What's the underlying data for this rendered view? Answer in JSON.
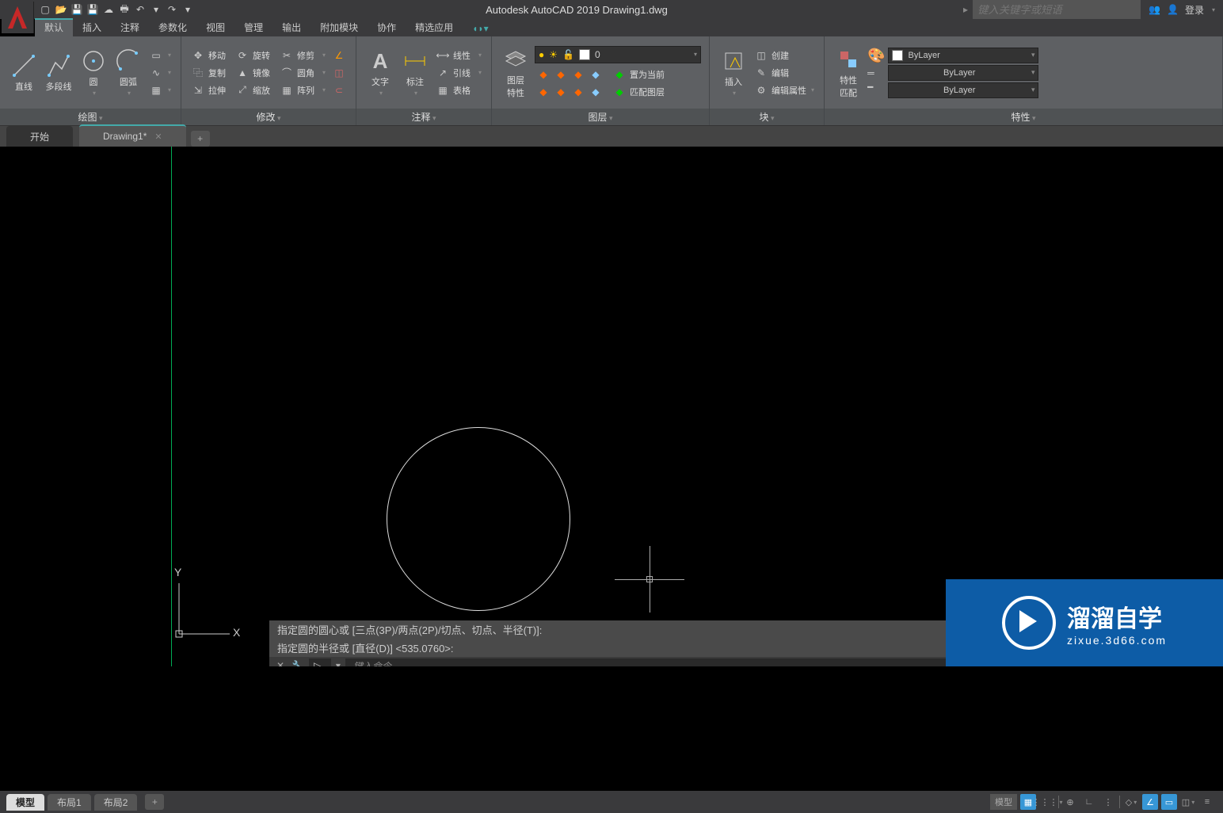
{
  "app": {
    "title": "Autodesk AutoCAD 2019    Drawing1.dwg"
  },
  "search": {
    "placeholder": "键入关键字或短语"
  },
  "login": "登录",
  "ribbon_tabs": [
    "默认",
    "插入",
    "注释",
    "参数化",
    "视图",
    "管理",
    "输出",
    "附加模块",
    "协作",
    "精选应用"
  ],
  "panels": {
    "draw": {
      "title": "绘图",
      "line": "直线",
      "polyline": "多段线",
      "circle": "圆",
      "arc": "圆弧"
    },
    "modify": {
      "title": "修改",
      "move": "移动",
      "rotate": "旋转",
      "trim": "修剪",
      "copy": "复制",
      "mirror": "镜像",
      "fillet": "圆角",
      "stretch": "拉伸",
      "scale": "缩放",
      "array": "阵列"
    },
    "annot": {
      "title": "注释",
      "text": "文字",
      "dim": "标注",
      "ltype": "线性",
      "leader": "引线",
      "table": "表格"
    },
    "layers": {
      "title": "图层",
      "prop": "图层\n特性",
      "current": "0",
      "setcurrent": "置为当前",
      "match": "匹配图层"
    },
    "block": {
      "title": "块",
      "insert": "插入",
      "create": "创建",
      "edit": "编辑",
      "editattr": "编辑属性"
    },
    "props": {
      "title": "特性",
      "match": "特性\n匹配",
      "bylayer": "ByLayer",
      "bylayer2": "ByLayer",
      "bylayer3": "ByLayer"
    }
  },
  "file_tabs": {
    "start": "开始",
    "drawing": "Drawing1*"
  },
  "ucs": {
    "x": "X",
    "y": "Y"
  },
  "cmd_hist1": "指定圆的圆心或 [三点(3P)/两点(2P)/切点、切点、半径(T)]:",
  "cmd_hist2": "指定圆的半径或 [直径(D)] <535.0760>:",
  "cmd_prompt": "键入命令",
  "status": {
    "model": "模型",
    "layout1": "布局1",
    "layout2": "布局2",
    "model_btn": "模型"
  },
  "watermark": {
    "title": "溜溜自学",
    "url": "zixue.3d66.com"
  }
}
